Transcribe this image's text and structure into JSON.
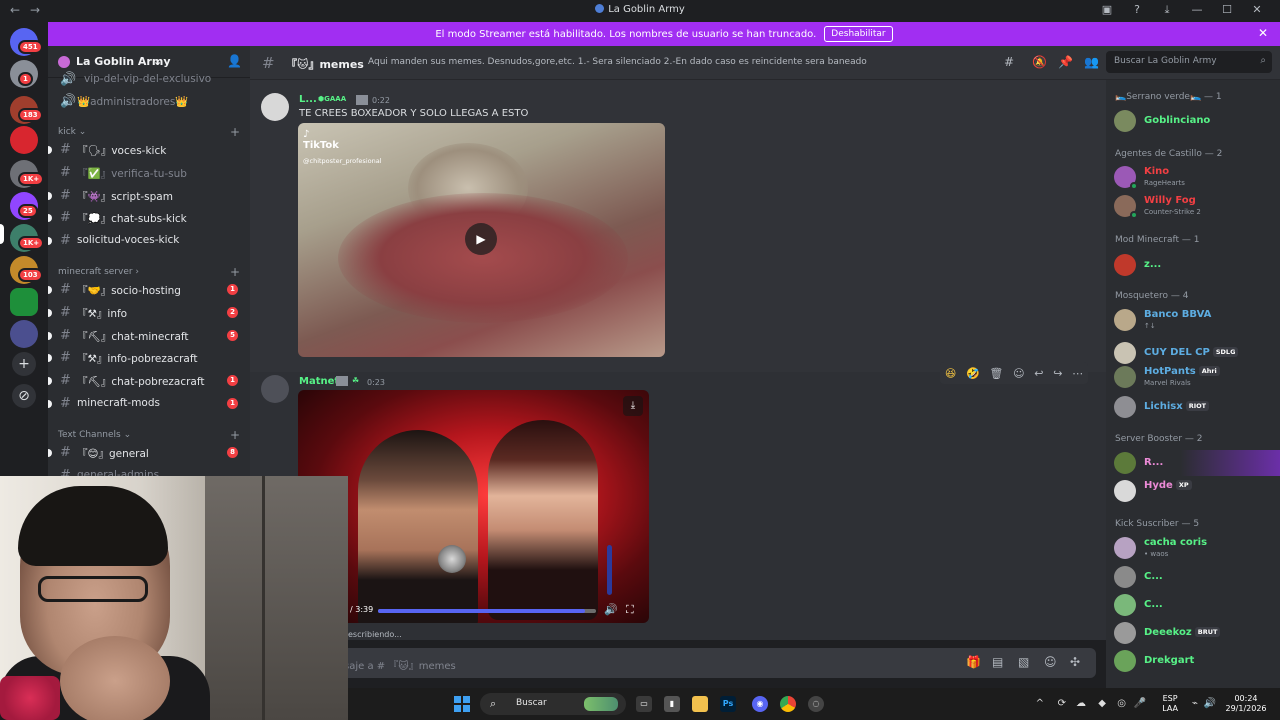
{
  "window": {
    "title": "La Goblin Army"
  },
  "banner": {
    "text": "El modo Streamer está habilitado. Los nombres de usuario se han truncado.",
    "button": "Deshabilitar"
  },
  "rail": {
    "badges": [
      "451",
      "1",
      "183",
      "1K+",
      "25",
      "1K+",
      "103"
    ]
  },
  "guild": {
    "name": "La Goblin Army"
  },
  "channels": {
    "top_partial": "vip-del-vip-del-exclusivo",
    "top_partial2": "👑administradores👑",
    "cat_kick": "kick",
    "kick": [
      {
        "name": "『🗣』voces-kick"
      },
      {
        "name": "『✅』verifica-tu-sub"
      },
      {
        "name": "『👾』script-spam"
      },
      {
        "name": "『💭』chat-subs-kick"
      },
      {
        "name": "solicitud-voces-kick"
      }
    ],
    "cat_minecraft": "minecraft server",
    "minecraft": [
      {
        "name": "『🤝』socio-hosting",
        "badge": "1"
      },
      {
        "name": "『⚒』info",
        "badge": "2"
      },
      {
        "name": "『⛏』chat-minecraft",
        "badge": "5"
      },
      {
        "name": "『⚒』info-pobrezacraft"
      },
      {
        "name": "『⛏』chat-pobrezacraft",
        "badge": "1"
      },
      {
        "name": "minecraft-mods",
        "badge": "1"
      }
    ],
    "cat_text": "Text Channels",
    "text": [
      {
        "name": "『😊』general",
        "badge": "8"
      },
      {
        "name": "general-admins"
      }
    ]
  },
  "header": {
    "channel": "『🐱』memes",
    "topic": "Aqui manden sus memes. Desnudos,gore,etc. 1.- Sera silenciado 2.-En dado caso es reincidente sera baneado",
    "search_placeholder": "Buscar La Goblin Army"
  },
  "messages": [
    {
      "author": "L...",
      "role_tag": "GAAA",
      "time": "0:22",
      "text": "TE CREES BOXEADOR Y SOLO LLEGAS A ESTO",
      "video": {
        "brand": "TikTok",
        "handle": "@chitposter_profesional"
      }
    },
    {
      "author": "Matnet",
      "time": "0:23",
      "video": {
        "time": "/ 3:39",
        "progress": 0.95
      }
    }
  ],
  "typing": "escribiendo...",
  "composer": {
    "placeholder": "saje a # 『🐱』memes"
  },
  "members": {
    "groups": [
      {
        "title": "🛌Serrano verde🛌 — 1",
        "members": [
          {
            "name": "Goblinciano",
            "color": "#57f287"
          }
        ]
      },
      {
        "title": "Agentes de Castillo — 2",
        "members": [
          {
            "name": "Kino",
            "color": "#f23f43",
            "status": "RageHearts"
          },
          {
            "name": "Willy Fog",
            "color": "#f23f43",
            "status": "Counter-Strike 2"
          }
        ]
      },
      {
        "title": "Mod Minecraft — 1",
        "members": [
          {
            "name": "z...",
            "color": "#57f287"
          }
        ]
      },
      {
        "title": "Mosquetero — 4",
        "members": [
          {
            "name": "Banco BBVA",
            "color": "#5dade2",
            "status": "↑↓"
          },
          {
            "name": "CUY DEL CP",
            "color": "#5dade2",
            "tag": "SDLG"
          },
          {
            "name": "HotPants",
            "color": "#5dade2",
            "tag": "Ahri",
            "status": "Marvel Rivals"
          },
          {
            "name": "Lichisx",
            "color": "#5dade2",
            "tag": "RIOT"
          }
        ]
      },
      {
        "title": "Server Booster — 2",
        "members": [
          {
            "name": "R...",
            "color": "#eb8ad6"
          },
          {
            "name": "Hyde",
            "color": "#eb8ad6",
            "tag": "XP"
          }
        ]
      },
      {
        "title": "Kick Suscriber — 5",
        "members": [
          {
            "name": "cacha coris",
            "color": "#57f287",
            "status": "• waos"
          },
          {
            "name": "C...",
            "color": "#57f287"
          },
          {
            "name": "C...",
            "color": "#57f287"
          },
          {
            "name": "Deeekoz",
            "color": "#57f287",
            "tag": "BRUT"
          },
          {
            "name": "Drekgart",
            "color": "#57f287"
          }
        ]
      }
    ]
  },
  "taskbar": {
    "search": "Buscar",
    "lang": "ESP",
    "lang2": "LAA",
    "time": "00:24",
    "date": "29/1/2026"
  },
  "colors": {
    "accent": "#5865f2",
    "banner": "#a12ef2",
    "mention": "#f23f43"
  }
}
